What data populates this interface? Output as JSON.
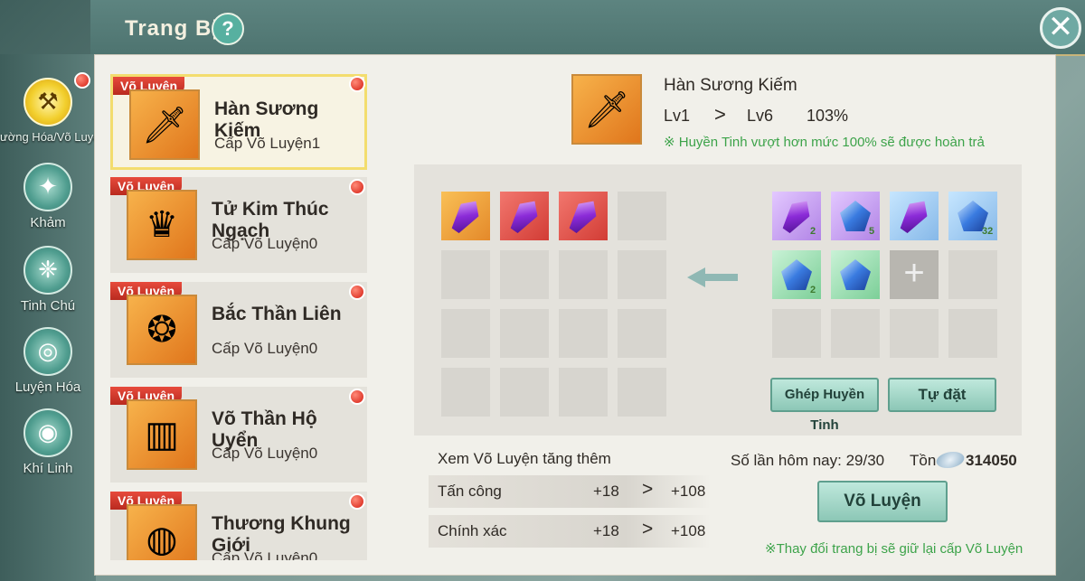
{
  "header": {
    "title": "Trang Bị",
    "help_label": "?",
    "close_label": "✕"
  },
  "sidebar": {
    "items": [
      {
        "label": "ường Hóa/Võ Luyện",
        "icon": "hammer-icon",
        "active": true
      },
      {
        "label": "Khảm",
        "icon": "inlay-icon"
      },
      {
        "label": "Tinh Chú",
        "icon": "rune-icon"
      },
      {
        "label": "Luyện Hóa",
        "icon": "refine-icon"
      },
      {
        "label": "Khí Linh",
        "icon": "spirit-icon"
      }
    ]
  },
  "equipment": [
    {
      "tag": "Võ Luyện",
      "name": "Hàn Sương Kiếm",
      "level": "Cấp Võ Luyện1",
      "icon": "sword-icon",
      "selected": true
    },
    {
      "tag": "Võ Luyện",
      "name": "Tử Kim Thúc Ngạch",
      "level": "Cấp Võ Luyện0",
      "icon": "headband-icon"
    },
    {
      "tag": "Võ Luyện",
      "name": "Bắc Thần Liên",
      "level": "Cấp Võ Luyện0",
      "icon": "necklace-icon"
    },
    {
      "tag": "Võ Luyện",
      "name": "Võ Thần Hộ Uyển",
      "level": "Cấp Võ Luyện0",
      "icon": "bracer-icon"
    },
    {
      "tag": "Võ Luyện",
      "name": "Thương Khung Giới",
      "level": "Cấp Võ Luyện0",
      "icon": "ring-icon"
    }
  ],
  "selected": {
    "name": "Hàn Sương Kiếm",
    "lv_from": "Lv1",
    "arrow": ">",
    "lv_to": "Lv6",
    "percent": "103%",
    "note": "※ Huyền Tinh vượt hơn mức 100% sẽ được hoàn trả"
  },
  "inventory": {
    "counts": [
      "2",
      "5",
      "",
      "32",
      "2",
      ""
    ]
  },
  "buttons": {
    "combine": "Ghép Huyền Tinh",
    "auto": "Tự đặt",
    "forge": "Võ Luyện"
  },
  "bonus": {
    "title": "Xem Võ Luyện tăng thêm",
    "rows": [
      {
        "label": "Tấn công",
        "from": "+18",
        "arrow": ">",
        "to": "+108"
      },
      {
        "label": "Chính xác",
        "from": "+18",
        "arrow": ">",
        "to": "+108"
      }
    ]
  },
  "status": {
    "times_today": "Số lần hôm nay: 29/30",
    "balance_label": "Tồn",
    "balance_value": "314050",
    "bottom_note": "※Thay đổi trang bị sẽ giữ lại cấp Võ Luyện"
  }
}
